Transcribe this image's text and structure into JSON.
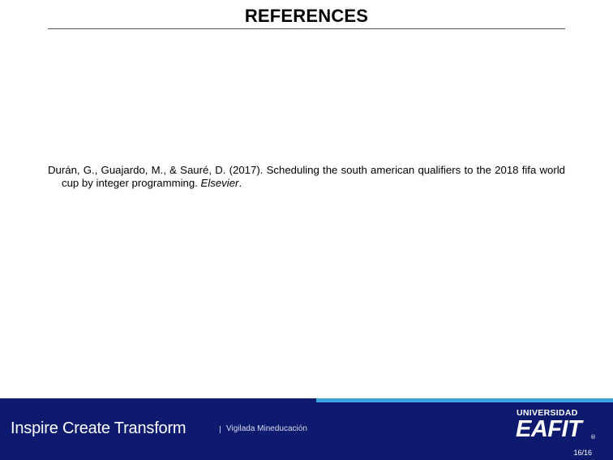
{
  "slide": {
    "title": "REFERENCES"
  },
  "references": [
    {
      "citation": "Durán, G., Guajardo, M., & Sauré, D. (2017). Scheduling the south american qualifiers to the 2018 fifa world cup by integer programming.",
      "journal": "Elsevier",
      "end": "."
    }
  ],
  "footer": {
    "slogan": "Inspire Create Transform",
    "separator": "|",
    "vigilada": "Vigilada Mineducación",
    "logo_top": "UNIVERSIDAD",
    "logo_main": "EAFIT",
    "logo_reg": "®",
    "page_number": "16/16",
    "colors": {
      "bar": "#0d1a6e",
      "accent": "#3fa0e0",
      "text": "#ffffff"
    }
  }
}
